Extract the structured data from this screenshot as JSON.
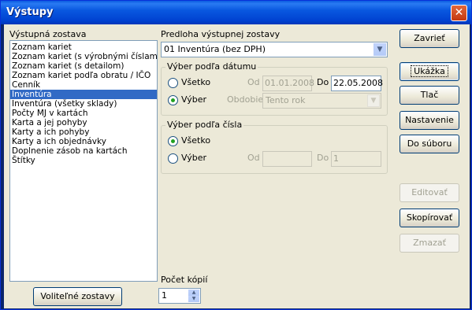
{
  "window": {
    "title": "Výstupy",
    "close_glyph": "✕"
  },
  "left": {
    "label": "Výstupná zostava",
    "items": [
      "Zoznam kariet",
      "Zoznam kariet (s výrobnými číslami)",
      "Zoznam kariet (s detailom)",
      "Zoznam kariet podľa obratu / IČO",
      "Cenník",
      "Inventúra",
      "Inventúra (všetky sklady)",
      "Počty MJ v kartách",
      "Karta a jej pohyby",
      "Karty a ich pohyby",
      "Karty a ich objednávky",
      "Doplnenie zásob na kartách",
      "Štítky"
    ],
    "selected_index": 5,
    "optional_button": "Voliteľné zostavy"
  },
  "template": {
    "label": "Predloha výstupnej zostavy",
    "value": "01 Inventúra (bez DPH)"
  },
  "date_group": {
    "title": "Výber podľa dátumu",
    "all_label": "Všetko",
    "select_label": "Výber",
    "from_label": "Od",
    "from_value": "01.01.2008",
    "to_label": "Do",
    "to_value": "22.05.2008",
    "period_label": "Obdobie",
    "period_value": "Tento rok",
    "selected": "select"
  },
  "number_group": {
    "title": "Výber podľa čísla",
    "all_label": "Všetko",
    "select_label": "Výber",
    "from_label": "Od",
    "from_value": "",
    "to_label": "Do",
    "to_value": "1",
    "selected": "all"
  },
  "copies": {
    "label": "Počet kópií",
    "value": "1"
  },
  "buttons": {
    "close": "Zavrieť",
    "preview": "Ukážka",
    "print": "Tlač",
    "settings": "Nastavenie",
    "to_file": "Do súboru",
    "edit": "Editovať",
    "copy": "Skopírovať",
    "delete": "Zmazať"
  },
  "icons": {
    "dropdown": "chevron-down-icon",
    "spin_up": "spin-up-icon",
    "spin_down": "spin-down-icon"
  }
}
